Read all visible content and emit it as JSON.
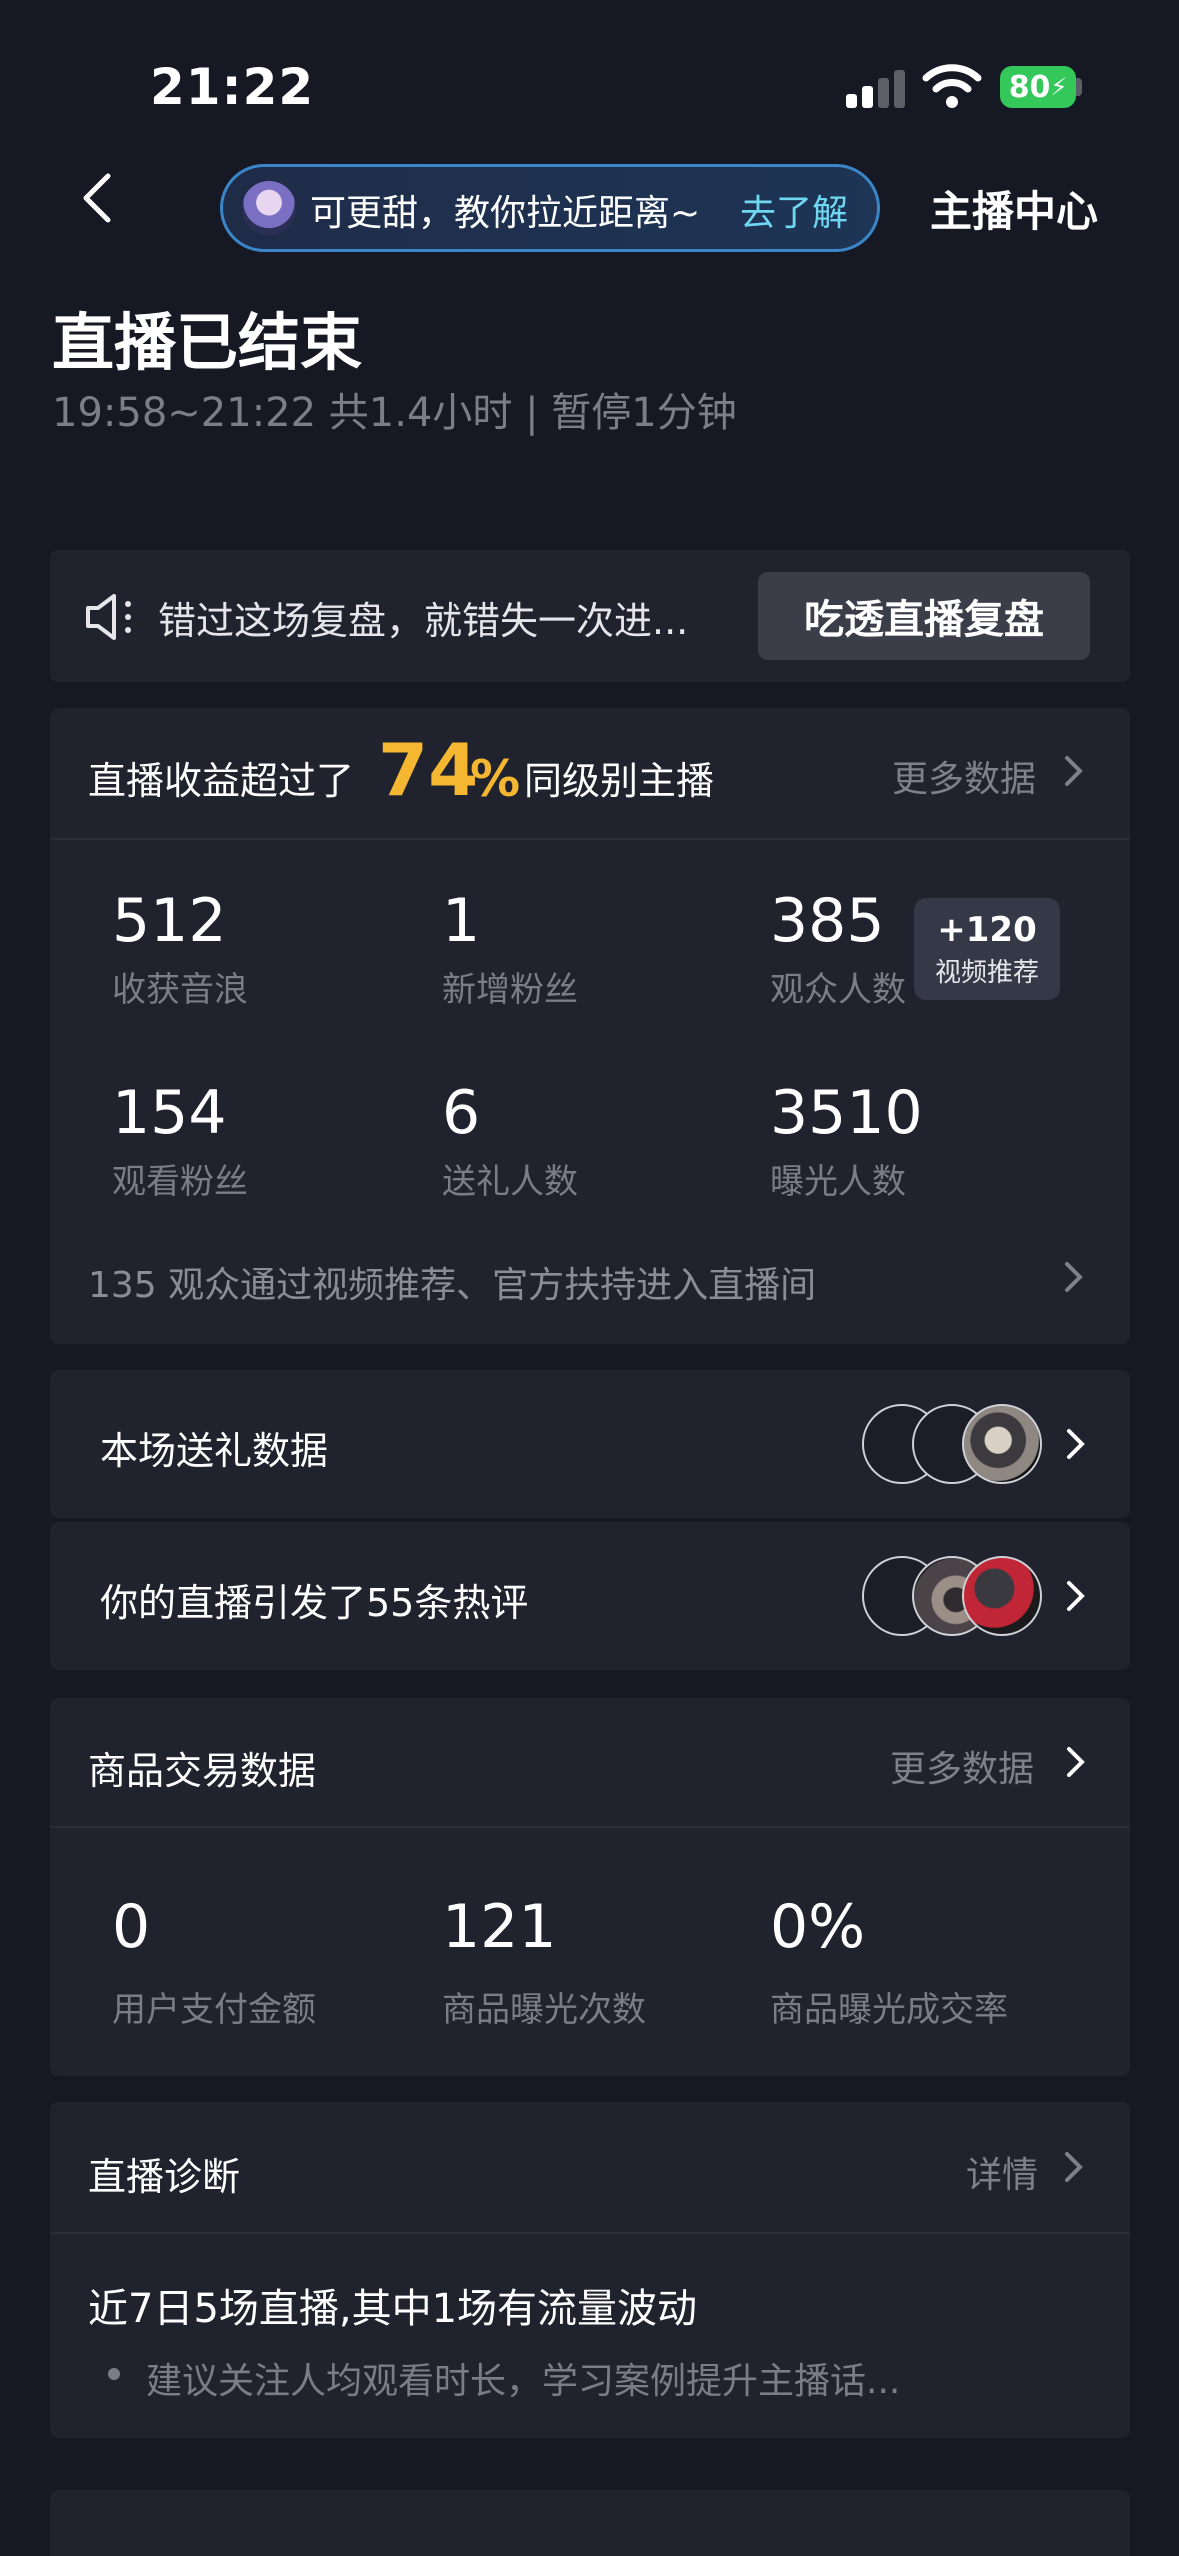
{
  "status_bar": {
    "time": "21:22",
    "battery": "80"
  },
  "nav": {
    "banner_text": "可更甜，教你拉近距离~",
    "banner_link": "去了解",
    "right_label": "主播中心"
  },
  "header": {
    "title": "直播已结束",
    "subtitle": "19:58~21:22 共1.4小时 | 暂停1分钟"
  },
  "replay": {
    "text": "错过这场复盘，就错失一次进...",
    "button": "吃透直播复盘"
  },
  "stats": {
    "head_prefix": "直播收益超过了",
    "percent": "74",
    "percent_sign": "%",
    "head_suffix": "同级别主播",
    "more": "更多数据",
    "items": [
      {
        "value": "512",
        "label": "收获音浪"
      },
      {
        "value": "1",
        "label": "新增粉丝"
      },
      {
        "value": "385",
        "label": "观众人数"
      },
      {
        "value": "154",
        "label": "观看粉丝"
      },
      {
        "value": "6",
        "label": "送礼人数"
      },
      {
        "value": "3510",
        "label": "曝光人数"
      }
    ],
    "badge_value": "+120",
    "badge_label": "视频推荐",
    "footer": "135 观众通过视频推荐、官方扶持进入直播间"
  },
  "gifts_row": {
    "label": "本场送礼数据"
  },
  "comments_row": {
    "label": "你的直播引发了55条热评"
  },
  "goods": {
    "title": "商品交易数据",
    "more": "更多数据",
    "items": [
      {
        "value": "0",
        "label": "用户支付金额"
      },
      {
        "value": "121",
        "label": "商品曝光次数"
      },
      {
        "value": "0%",
        "label": "商品曝光成交率"
      }
    ]
  },
  "diagnosis": {
    "title": "直播诊断",
    "more": "详情",
    "headline": "近7日5场直播,其中1场有流量波动",
    "bullet": "建议关注人均观看时长，学习案例提升主播话..."
  },
  "colors": {
    "background": "#161823",
    "card": "#20222d",
    "accent": "#f5b731",
    "link": "#6fd7f2"
  }
}
